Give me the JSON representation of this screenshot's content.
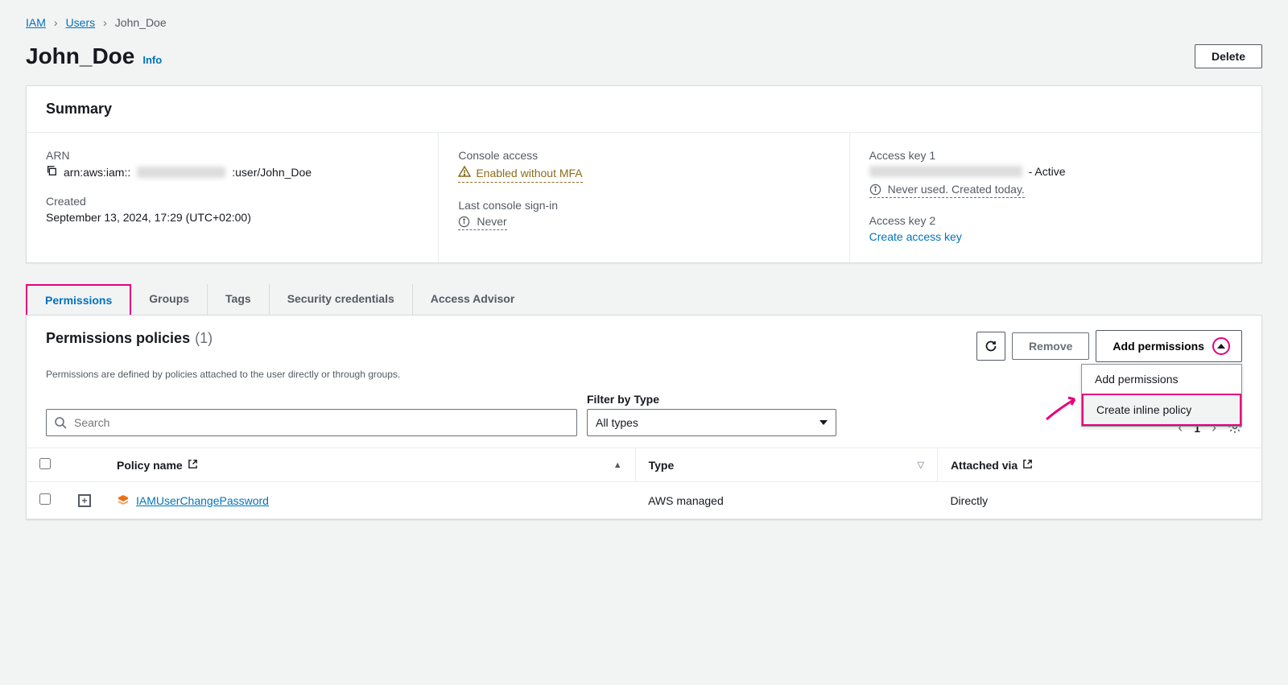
{
  "breadcrumb": {
    "iam": "IAM",
    "users": "Users",
    "current": "John_Doe"
  },
  "header": {
    "title": "John_Doe",
    "info": "Info",
    "delete": "Delete"
  },
  "summary": {
    "title": "Summary",
    "arn_label": "ARN",
    "arn_prefix": "arn:aws:iam::",
    "arn_suffix": ":user/John_Doe",
    "created_label": "Created",
    "created_value": "September 13, 2024, 17:29 (UTC+02:00)",
    "console_label": "Console access",
    "console_value": "Enabled without MFA",
    "signin_label": "Last console sign-in",
    "signin_value": "Never",
    "ak1_label": "Access key 1",
    "ak1_status": " - Active",
    "ak1_note": "Never used. Created today.",
    "ak2_label": "Access key 2",
    "ak2_link": "Create access key"
  },
  "tabs": {
    "permissions": "Permissions",
    "groups": "Groups",
    "tags": "Tags",
    "security": "Security credentials",
    "advisor": "Access Advisor"
  },
  "policies": {
    "title": "Permissions policies",
    "count": "(1)",
    "subtitle": "Permissions are defined by policies attached to the user directly or through groups.",
    "remove": "Remove",
    "add": "Add permissions",
    "dropdown_add": "Add permissions",
    "dropdown_inline": "Create inline policy",
    "search_placeholder": "Search",
    "filter_label": "Filter by Type",
    "filter_value": "All types",
    "page": "1",
    "th_policy": "Policy name",
    "th_type": "Type",
    "th_attached": "Attached via",
    "row": {
      "name": "IAMUserChangePassword",
      "type": "AWS managed",
      "attached": "Directly"
    }
  }
}
